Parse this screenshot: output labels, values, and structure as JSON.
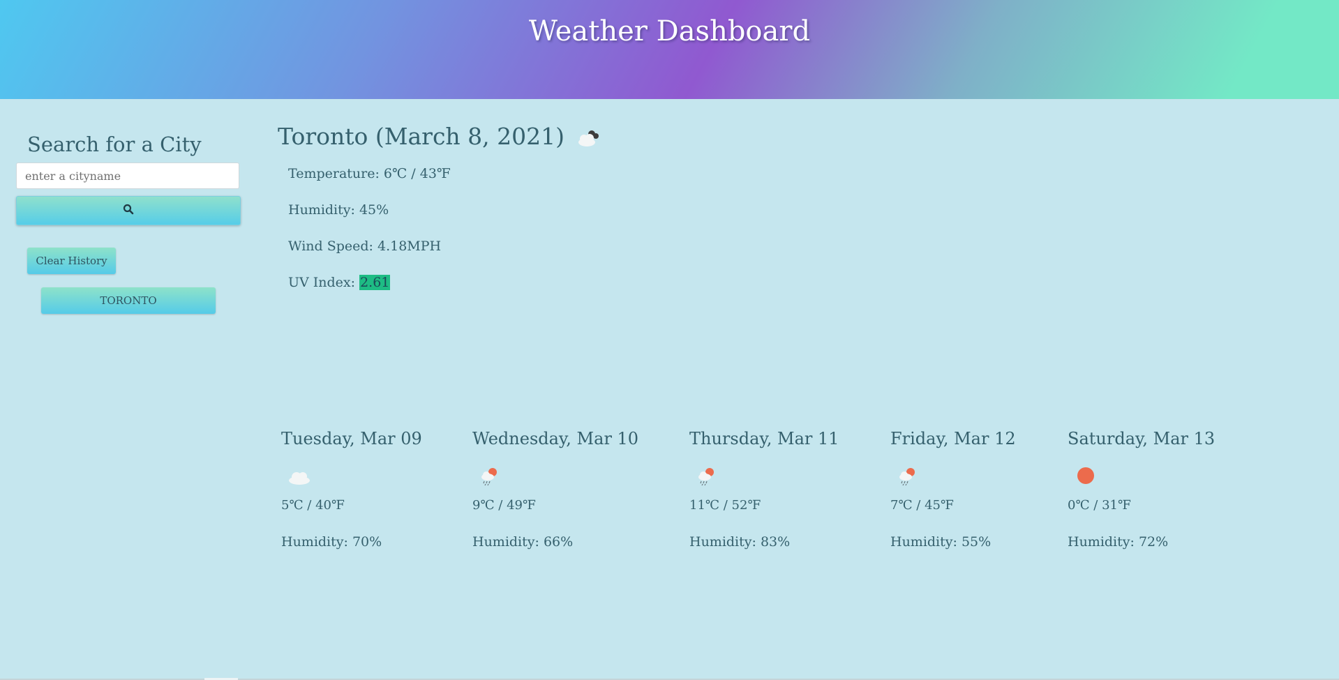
{
  "header": {
    "title": "Weather Dashboard"
  },
  "sidebar": {
    "search_title": "Search for a City",
    "search_placeholder": "enter a cityname",
    "search_value": "",
    "search_icon": "search-icon",
    "clear_label": "Clear History",
    "history": [
      "TORONTO"
    ]
  },
  "current": {
    "title": "Toronto (March 8, 2021)",
    "icon": "partly-cloudy-night-icon",
    "temperature": "Temperature: 6℃ / 43℉",
    "humidity": "Humidity: 45%",
    "wind": "Wind Speed: 4.18MPH",
    "uv_label": "UV Index: ",
    "uv_value": "2.61",
    "uv_color": "#1ebc84"
  },
  "forecast": [
    {
      "date": "Tuesday, Mar 09",
      "icon": "cloud-icon",
      "temp": "5℃ / 40℉",
      "humidity": "Humidity: 70%"
    },
    {
      "date": "Wednesday, Mar 10",
      "icon": "sun-rain-icon",
      "temp": "9℃ / 49℉",
      "humidity": "Humidity: 66%"
    },
    {
      "date": "Thursday, Mar 11",
      "icon": "sun-rain-icon",
      "temp": "11℃ / 52℉",
      "humidity": "Humidity: 83%"
    },
    {
      "date": "Friday, Mar 12",
      "icon": "sun-rain-icon",
      "temp": "7℃ / 45℉",
      "humidity": "Humidity: 55%"
    },
    {
      "date": "Saturday, Mar 13",
      "icon": "sun-icon",
      "temp": "0℃ / 31℉",
      "humidity": "Humidity: 72%"
    }
  ],
  "colors": {
    "background": "#c5e6ee",
    "text": "#35606d",
    "button_top": "#8ee2c9",
    "button_bottom": "#55cbe8",
    "sun": "#ec6b4c"
  }
}
